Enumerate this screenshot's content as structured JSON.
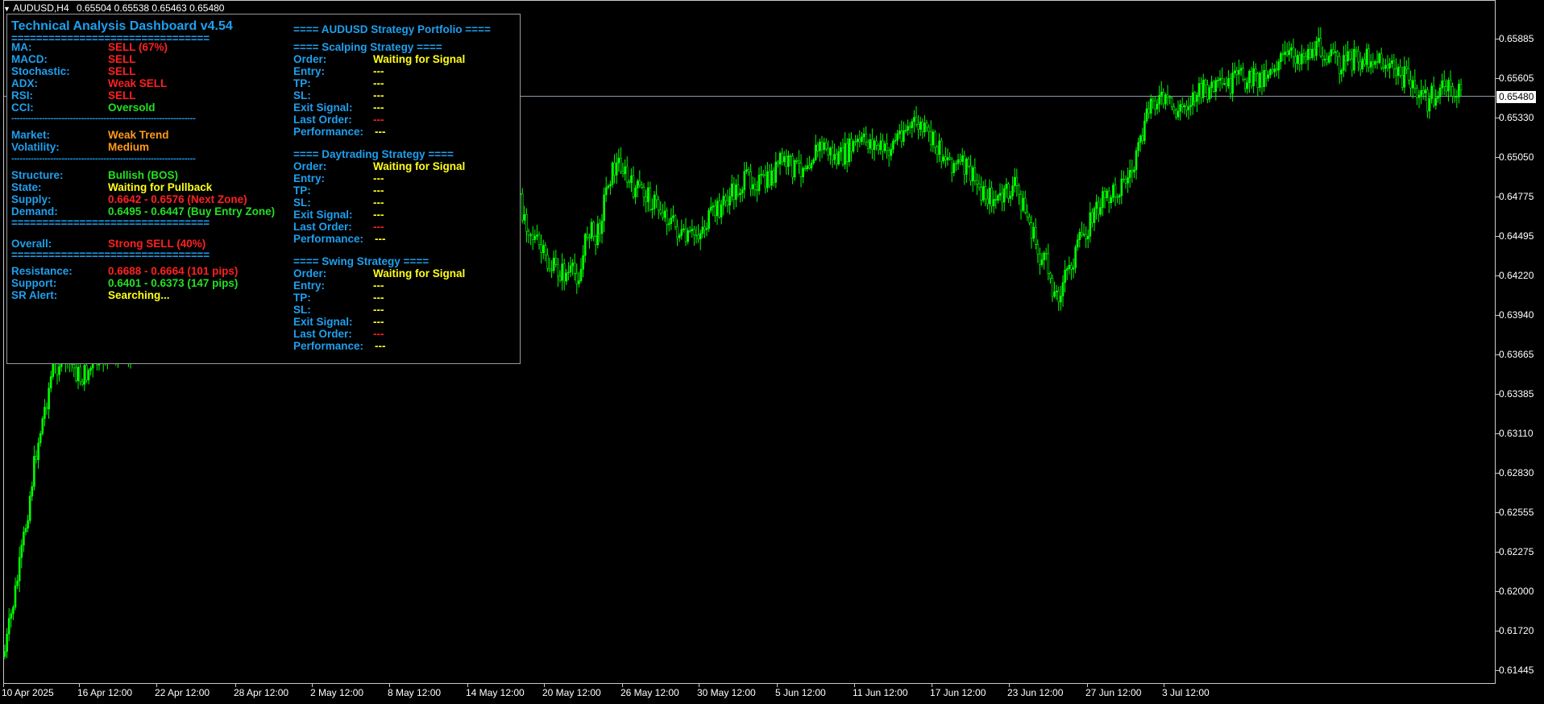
{
  "symbol_bar": {
    "symbol": "AUDUSD,H4",
    "ohlc": "0.65504 0.65538 0.65463 0.65480"
  },
  "price_axis": [
    "0.65885",
    "0.65605",
    "0.65330",
    "0.65050",
    "0.64775",
    "0.64495",
    "0.64220",
    "0.63940",
    "0.63665",
    "0.63385",
    "0.63110",
    "0.62830",
    "0.62555",
    "0.62275",
    "0.62000",
    "0.61720",
    "0.61445"
  ],
  "current_price": "0.65480",
  "time_axis": [
    "10 Apr 2025",
    "16 Apr 12:00",
    "22 Apr 12:00",
    "28 Apr 12:00",
    "2 May 12:00",
    "8 May 12:00",
    "14 May 12:00",
    "20 May 12:00",
    "26 May 12:00",
    "30 May 12:00",
    "5 Jun 12:00",
    "11 Jun 12:00",
    "17 Jun 12:00",
    "23 Jun 12:00",
    "27 Jun 12:00",
    "3 Jul 12:00"
  ],
  "colors": {
    "candle": "#00ff00",
    "background": "#000000",
    "accent": "#1ea0ee",
    "sell": "#ff2020",
    "buy": "#22e022",
    "warn": "#ff9a1a",
    "info": "#ffff1a"
  },
  "dashboard": {
    "title": "Technical Analysis Dashboard v4.54",
    "sep_long": "================================",
    "sep_dash": "------------------------------------------------------------------",
    "indicators": [
      {
        "label": "MA:",
        "value": "SELL (67%)"
      },
      {
        "label": "MACD:",
        "value": "SELL"
      },
      {
        "label": "Stochastic:",
        "value": "SELL"
      },
      {
        "label": "ADX:",
        "value": "Weak SELL"
      },
      {
        "label": "RSI:",
        "value": "SELL"
      },
      {
        "label": "CCI:",
        "value": "Oversold"
      }
    ],
    "market": {
      "label": "Market:",
      "value": "Weak Trend"
    },
    "volatility": {
      "label": "Volatility:",
      "value": "Medium"
    },
    "structure": {
      "label": "Structure:",
      "value": "Bullish (BOS)"
    },
    "state": {
      "label": "State:",
      "value": "Waiting for Pullback"
    },
    "supply": {
      "label": "Supply:",
      "value": "0.6642 - 0.6576 (Next Zone)"
    },
    "demand": {
      "label": "Demand:",
      "value": "0.6495 - 0.6447 (Buy Entry Zone)"
    },
    "overall": {
      "label": "Overall:",
      "value": "Strong SELL (40%)"
    },
    "resistance": {
      "label": "Resistance:",
      "value": "0.6688 - 0.6664 (101 pips)"
    },
    "support": {
      "label": "Support:",
      "value": "0.6401 - 0.6373 (147 pips)"
    },
    "sr_alert": {
      "label": "SR Alert:",
      "value": "Searching..."
    }
  },
  "portfolio": {
    "title": "==== AUDUSD Strategy Portfolio ====",
    "field_labels": {
      "order": "Order:",
      "entry": "Entry:",
      "tp": "TP:",
      "sl": "SL:",
      "exit": "Exit Signal:",
      "last": "Last Order:",
      "perf": "Performance:"
    },
    "strategies": [
      {
        "title": "==== Scalping Strategy ====",
        "order": "Waiting for Signal",
        "entry": "---",
        "tp": "---",
        "sl": "---",
        "exit": "---",
        "last": "---",
        "perf": "---"
      },
      {
        "title": "==== Daytrading Strategy ====",
        "order": "Waiting for Signal",
        "entry": "---",
        "tp": "---",
        "sl": "---",
        "exit": "---",
        "last": "---",
        "perf": "---"
      },
      {
        "title": "==== Swing Strategy ====",
        "order": "Waiting for Signal",
        "entry": "---",
        "tp": "---",
        "sl": "---",
        "exit": "---",
        "last": "---",
        "perf": "---"
      }
    ]
  }
}
